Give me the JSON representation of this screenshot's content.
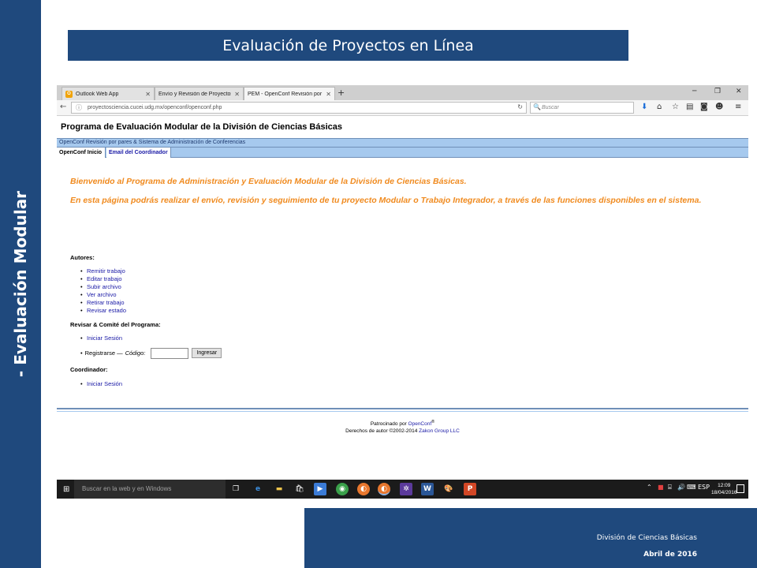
{
  "slide": {
    "title": "Evaluación de Proyectos en Línea",
    "side_label": "- Evaluación Modular",
    "footer_dept": "División de Ciencias Básicas",
    "footer_date": "Abril de 2016"
  },
  "browser": {
    "tabs": [
      {
        "label": "Outlook Web App",
        "favicon": "O"
      },
      {
        "label": "Envío y Revisión de Proyectos ...",
        "favicon": ""
      },
      {
        "label": "PEM - OpenConf Revisión por ...",
        "favicon": ""
      }
    ],
    "new_tab": "+",
    "url": "proyectosciencia.cucei.udg.mx/openconf/openconf.php",
    "search_placeholder": "Buscar"
  },
  "page": {
    "program_title": "Programa de Evaluación Modular de la División de Ciencias Básicas",
    "openconf_bar": "OpenConf Revisión por pares & Sistema de Administración de Conferencias",
    "nav_tabs": [
      "OpenConf Inicio",
      "Email del Coordinador"
    ],
    "welcome_1": "Bienvenido al Programa de Administración y Evaluación Modular de la División de Ciencias Básicas.",
    "welcome_2": "En esta página podrás realizar el envío, revisión y seguimiento de tu proyecto Modular o Trabajo Integrador, a través de las funciones disponibles en el sistema.",
    "authors_heading": "Autores:",
    "authors_links": [
      "Remitir trabajo",
      "Editar trabajo",
      "Subir archivo",
      "Ver archivo",
      "Retirar trabajo",
      "Revisar estado"
    ],
    "reviewers_heading": "Revisar & Comité del Programa:",
    "reviewers_links": [
      "Iniciar Sesión"
    ],
    "register_label": "Registrarse —",
    "code_label": "Código:",
    "register_button": "Ingresar",
    "coordinator_heading": "Coordinador:",
    "coordinator_links": [
      "Iniciar Sesión"
    ],
    "sponsor_prefix": "Patrocinado por",
    "sponsor_link": "OpenConf",
    "sponsor_mark": "®",
    "copyright_prefix": "Derechos de autor ©2002-2014",
    "copyright_link": "Zakon Group LLC"
  },
  "taskbar": {
    "search_placeholder": "Buscar en la web y en Windows",
    "lang": "ESP",
    "time": "12:09",
    "date": "18/04/2016"
  },
  "colors": {
    "slide_blue": "#1f497d",
    "welcome_orange": "#f08a1e",
    "link_blue": "#1a1aa6",
    "openconf_bar": "#a6c9ee"
  }
}
